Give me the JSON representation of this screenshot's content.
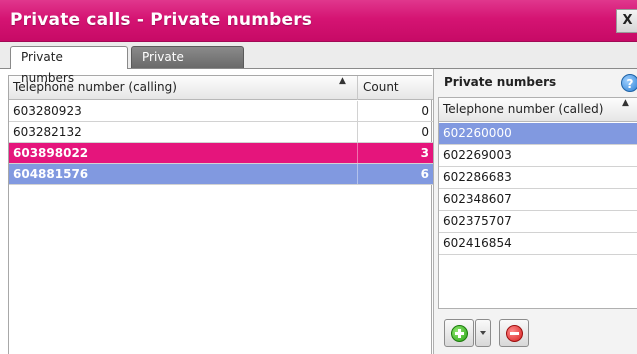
{
  "window": {
    "title": "Private calls - Private numbers",
    "close_label": "X"
  },
  "tabs": [
    {
      "label": "Private numbers",
      "active": true
    },
    {
      "label": "Private services",
      "active": false
    }
  ],
  "left_grid": {
    "columns": [
      "Telephone number (calling)",
      "Count"
    ],
    "sort_indicator": "▲",
    "rows": [
      {
        "number": "603280923",
        "count": "0",
        "state": "normal"
      },
      {
        "number": "603282132",
        "count": "0",
        "state": "normal"
      },
      {
        "number": "603898022",
        "count": "3",
        "state": "selected-pink"
      },
      {
        "number": "604881576",
        "count": "6",
        "state": "selected-blue"
      }
    ]
  },
  "right_panel": {
    "title": "Private numbers",
    "help_label": "?",
    "column": "Telephone number (called)",
    "sort_indicator": "▲",
    "rows": [
      {
        "number": "602260000",
        "selected": true
      },
      {
        "number": "602269003",
        "selected": false
      },
      {
        "number": "602286683",
        "selected": false
      },
      {
        "number": "602348607",
        "selected": false
      },
      {
        "number": "602375707",
        "selected": false
      },
      {
        "number": "602416854",
        "selected": false
      }
    ],
    "toolbar": {
      "add_icon": "add-icon",
      "remove_icon": "remove-icon"
    }
  },
  "colors": {
    "title_bar": "#d51473",
    "pink_selection": "#e5157c",
    "blue_selection": "#8199e0"
  }
}
